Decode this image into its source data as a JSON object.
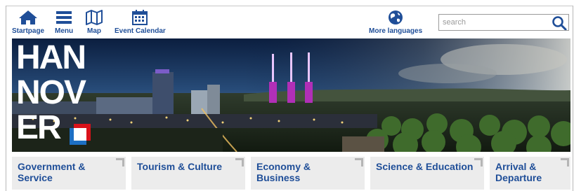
{
  "toolbar": {
    "startpage": {
      "label": "Startpage",
      "icon": "home-icon"
    },
    "menu": {
      "label": "Menu",
      "icon": "menu-icon"
    },
    "map": {
      "label": "Map",
      "icon": "map-icon"
    },
    "event_calendar": {
      "label": "Event Calendar",
      "icon": "calendar-icon"
    },
    "languages": {
      "label": "More languages",
      "icon": "globe-icon"
    }
  },
  "search": {
    "placeholder": "search",
    "value": "",
    "icon": "search-icon"
  },
  "banner": {
    "logo_lines": [
      "HAN",
      "NOV",
      "ER"
    ],
    "description": "Hanover city skyline at dusk"
  },
  "tiles": [
    {
      "label": "Government & Service"
    },
    {
      "label": "Tourism & Culture"
    },
    {
      "label": "Economy & Business"
    },
    {
      "label": "Science & Education"
    },
    {
      "label": "Arrival & Departure"
    }
  ],
  "colors": {
    "brand_blue": "#1f4e98",
    "tile_bg": "#ececec",
    "logo_red": "#d9121a",
    "logo_blue": "#1d6fc4"
  }
}
